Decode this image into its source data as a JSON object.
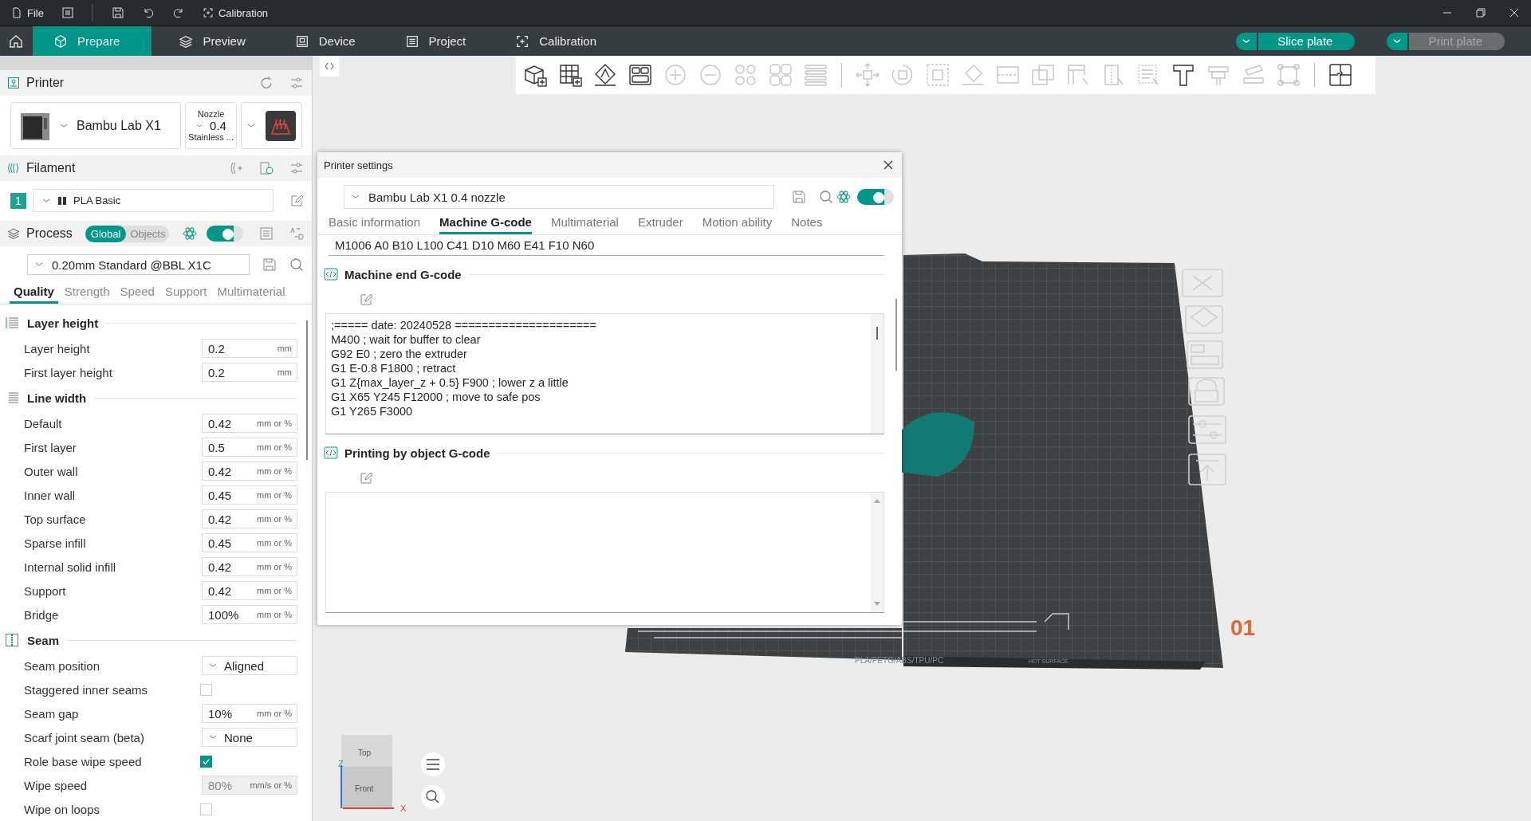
{
  "title_bar": {
    "menu": "File",
    "app_title": "Calibration"
  },
  "nav_tabs": [
    {
      "label": "Prepare",
      "kind": "cube",
      "selected": true
    },
    {
      "label": "Preview",
      "kind": "layers",
      "selected": false
    },
    {
      "label": "Device",
      "kind": "device",
      "selected": false
    },
    {
      "label": "Project",
      "kind": "list",
      "selected": false
    },
    {
      "label": "Calibration",
      "kind": "calib",
      "selected": false
    }
  ],
  "actions": [
    {
      "label": "Slice plate",
      "disabled": false
    },
    {
      "label": "Print plate",
      "disabled": true
    }
  ],
  "printer": {
    "heading": "Printer",
    "model": "Bambu Lab X1",
    "nozzle_label": "Nozzle",
    "nozzle_size": "0.4",
    "nozzle_type": "Stainless ..."
  },
  "filament": {
    "heading": "Filament",
    "slot": "1",
    "name": "PLA Basic"
  },
  "process": {
    "heading": "Process",
    "scopes": [
      {
        "label": "Global",
        "selected": true
      },
      {
        "label": "Objects",
        "selected": false
      }
    ],
    "advanced_on": true,
    "preset": "0.20mm Standard @BBL X1C",
    "tabs": [
      {
        "label": "Quality",
        "selected": true
      },
      {
        "label": "Strength",
        "selected": false
      },
      {
        "label": "Speed",
        "selected": false
      },
      {
        "label": "Support",
        "selected": false
      },
      {
        "label": "Multimaterial",
        "selected": false
      }
    ],
    "sections": [
      {
        "title": "Layer height",
        "kind": "layers",
        "rows": [
          {
            "label": "Layer height",
            "kind": "input",
            "value": "0.2",
            "unit": "mm",
            "disabled": false
          },
          {
            "label": "First layer height",
            "kind": "input",
            "value": "0.2",
            "unit": "mm",
            "disabled": false
          }
        ]
      },
      {
        "title": "Line width",
        "kind": "lines",
        "rows": [
          {
            "label": "Default",
            "kind": "input",
            "value": "0.42",
            "unit": "mm or %",
            "disabled": false
          },
          {
            "label": "First layer",
            "kind": "input",
            "value": "0.5",
            "unit": "mm or %",
            "disabled": false
          },
          {
            "label": "Outer wall",
            "kind": "input",
            "value": "0.42",
            "unit": "mm or %",
            "disabled": false
          },
          {
            "label": "Inner wall",
            "kind": "input",
            "value": "0.45",
            "unit": "mm or %",
            "disabled": false
          },
          {
            "label": "Top surface",
            "kind": "input",
            "value": "0.42",
            "unit": "mm or %",
            "disabled": false
          },
          {
            "label": "Sparse infill",
            "kind": "input",
            "value": "0.45",
            "unit": "mm or %",
            "disabled": false
          },
          {
            "label": "Internal solid infill",
            "kind": "input",
            "value": "0.42",
            "unit": "mm or %",
            "disabled": false
          },
          {
            "label": "Support",
            "kind": "input",
            "value": "0.42",
            "unit": "mm or %",
            "disabled": false
          },
          {
            "label": "Bridge",
            "kind": "input",
            "value": "100%",
            "unit": "mm or %",
            "disabled": false
          }
        ]
      },
      {
        "title": "Seam",
        "kind": "seam",
        "rows": [
          {
            "label": "Seam position",
            "kind": "select",
            "value": "Aligned"
          },
          {
            "label": "Staggered inner seams",
            "kind": "checkbox",
            "checked": false
          },
          {
            "label": "Seam gap",
            "kind": "input",
            "value": "10%",
            "unit": "mm or %",
            "disabled": false
          },
          {
            "label": "Scarf joint seam (beta)",
            "kind": "select",
            "value": "None"
          },
          {
            "label": "Role base wipe speed",
            "kind": "checkbox",
            "checked": true
          },
          {
            "label": "Wipe speed",
            "kind": "input",
            "value": "80%",
            "unit": "mm/s or %",
            "disabled": true
          },
          {
            "label": "Wipe on loops",
            "kind": "checkbox",
            "checked": false
          }
        ]
      }
    ]
  },
  "toolbar": [
    {
      "kind": "add-cube",
      "disabled": false
    },
    {
      "kind": "add-grid",
      "disabled": false
    },
    {
      "kind": "orient",
      "disabled": false
    },
    {
      "kind": "arrange",
      "disabled": false
    },
    {
      "kind": "add-circle",
      "disabled": true
    },
    {
      "kind": "remove-circle",
      "disabled": true
    },
    {
      "kind": "instances",
      "disabled": true
    },
    {
      "kind": "split",
      "disabled": true
    },
    {
      "kind": "layers",
      "disabled": true
    },
    {
      "kind": "separator"
    },
    {
      "kind": "move",
      "disabled": true
    },
    {
      "kind": "rotate",
      "disabled": true
    },
    {
      "kind": "scale",
      "disabled": true
    },
    {
      "kind": "flatten",
      "disabled": true
    },
    {
      "kind": "cut",
      "disabled": true
    },
    {
      "kind": "boolean",
      "disabled": true
    },
    {
      "kind": "paint-support",
      "disabled": true
    },
    {
      "kind": "paint-seam",
      "disabled": true
    },
    {
      "kind": "paint-fuzzy",
      "disabled": true
    },
    {
      "kind": "text",
      "disabled": false
    },
    {
      "kind": "measure",
      "disabled": true
    },
    {
      "kind": "emboss",
      "disabled": true
    },
    {
      "kind": "assembly",
      "disabled": true
    },
    {
      "kind": "separator"
    },
    {
      "kind": "puzzle",
      "disabled": false
    }
  ],
  "viewport": {
    "plate_number": "01",
    "plate_label": "PLA/PETG/ABS/TPU/PC",
    "plate_warning": "HOT SURFACE",
    "view_top": "Top",
    "view_front": "Front",
    "axis_z": "Z",
    "axis_x": "X"
  },
  "dialog": {
    "title": "Printer settings",
    "preset": "Bambu Lab X1 0.4 nozzle",
    "advanced_on": true,
    "tabs": [
      {
        "label": "Basic information",
        "selected": false
      },
      {
        "label": "Machine G-code",
        "selected": true
      },
      {
        "label": "Multimaterial",
        "selected": false
      },
      {
        "label": "Extruder",
        "selected": false
      },
      {
        "label": "Motion ability",
        "selected": false
      },
      {
        "label": "Notes",
        "selected": false
      }
    ],
    "code_above": "M1006 A0 B10 L100 C41 D10 M60 E41 F10 N60",
    "sections": [
      {
        "title": "Machine end G-code",
        "lines": [
          ";===== date: 20240528 =====================",
          "M400 ; wait for buffer to clear",
          "G92 E0 ; zero the extruder",
          "G1 E-0.8 F1800 ; retract",
          "G1 Z{max_layer_z + 0.5} F900 ; lower z a little",
          "G1 X65 Y245 F12000 ; move to safe pos",
          "G1 Y265 F3000"
        ]
      },
      {
        "title": "Printing by object G-code"
      }
    ]
  }
}
